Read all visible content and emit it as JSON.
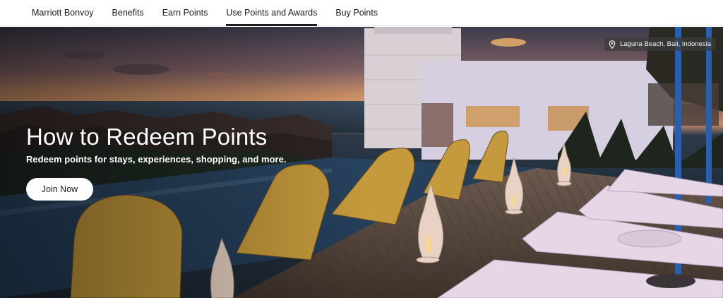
{
  "nav": {
    "items": [
      {
        "label": "Marriott Bonvoy",
        "active": false
      },
      {
        "label": "Benefits",
        "active": false
      },
      {
        "label": "Earn Points",
        "active": false
      },
      {
        "label": "Use Points and Awards",
        "active": true
      },
      {
        "label": "Buy Points",
        "active": false
      }
    ]
  },
  "hero": {
    "title": "How to Redeem Points",
    "subtitle": "Redeem points for stays, experiences, shopping, and more.",
    "cta_label": "Join Now",
    "location": "Laguna Beach, Bali, Indonesia",
    "location_icon": "map-pin-icon",
    "image_description_icon": "hotel-rooftop-pool-photo"
  },
  "colors": {
    "nav_text": "#1c1c1c",
    "active_underline": "#1c1c1c",
    "button_bg": "#ffffff",
    "hero_text": "#ffffff"
  }
}
